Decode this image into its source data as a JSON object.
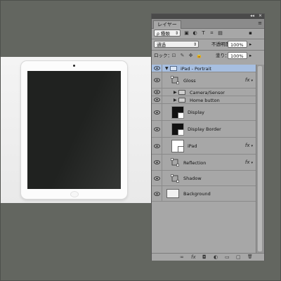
{
  "panel": {
    "tab_label": "レイヤー",
    "menu_label": "≡",
    "topbar_buttons": [
      "◂◂",
      "✕"
    ],
    "filter": {
      "value": "種類",
      "arrow": "⇕"
    },
    "blend_mode": {
      "value": "通過",
      "arrow": "⇕"
    },
    "opacity": {
      "label": "不透明度：",
      "value": "100%",
      "arrow": "▸"
    },
    "lock": {
      "label": "ロック："
    },
    "fill": {
      "label": "塗り：",
      "value": "100%",
      "arrow": "▸"
    }
  },
  "layers": [
    {
      "name": "iPad - Portrait",
      "type": "group-open",
      "selected": true
    },
    {
      "name": "Gloss",
      "type": "layer-adjust",
      "fx": "fx"
    },
    {
      "name": "Camera/Sensor",
      "type": "group-closed"
    },
    {
      "name": "Home button",
      "type": "group-closed"
    },
    {
      "name": "Display",
      "type": "layer-dark"
    },
    {
      "name": "Display Border",
      "type": "layer-dark"
    },
    {
      "name": "iPad",
      "type": "layer-white",
      "fx": "fx"
    },
    {
      "name": "Reflection",
      "type": "layer-adjust",
      "fx": "fx"
    },
    {
      "name": "Shadow",
      "type": "layer-adjust"
    },
    {
      "name": "Background",
      "type": "layer-bg"
    }
  ],
  "bottom_icons": [
    "∞",
    "fx",
    "◘",
    "◐",
    "▭",
    "▢",
    "🗑"
  ],
  "colors": {
    "selected_row": "#a7bfe1",
    "panel_bg": "#a7a7a7",
    "workspace": "#636660"
  }
}
